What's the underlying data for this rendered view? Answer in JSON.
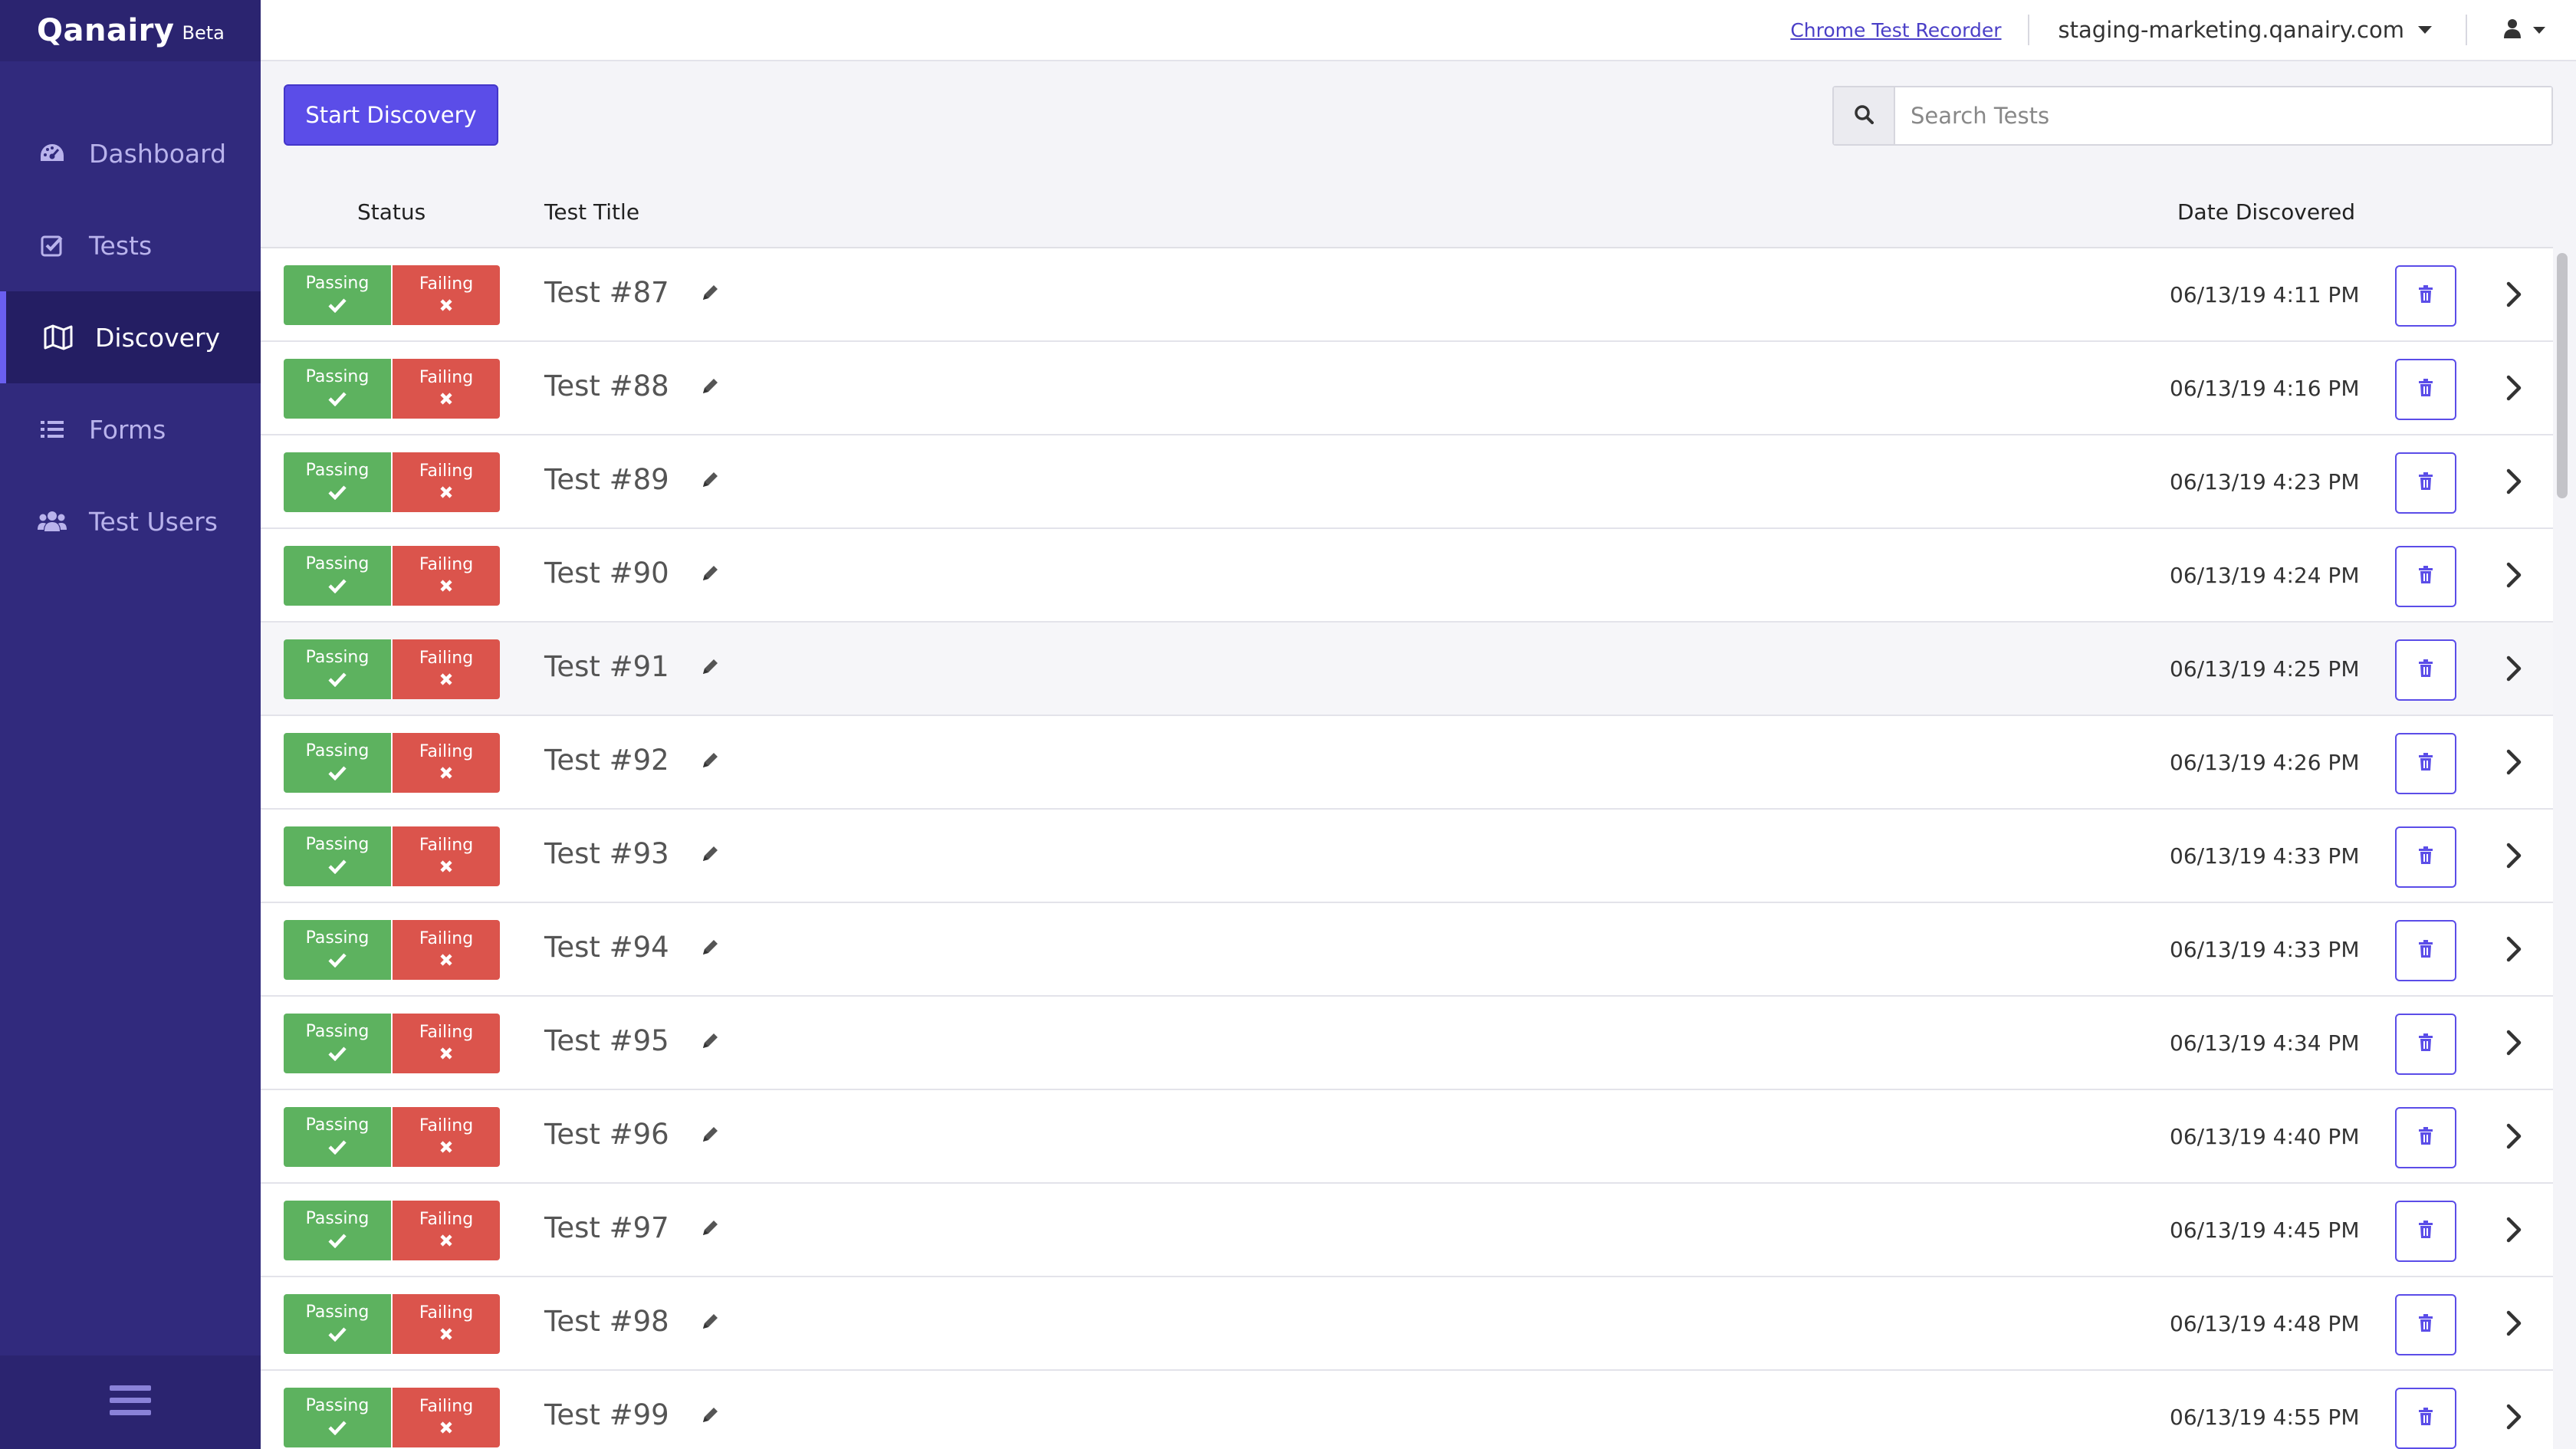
{
  "app": {
    "logo": "Qanairy",
    "beta_label": "Beta"
  },
  "topbar": {
    "recorder_link": "Chrome Test Recorder",
    "site": "staging-marketing.qanairy.com",
    "icons": [
      "user-icon",
      "caret-down-icon"
    ]
  },
  "sidebar": {
    "items": [
      {
        "label": "Dashboard",
        "icon": "dashboard-gauge-icon",
        "active": false
      },
      {
        "label": "Tests",
        "icon": "check-square-icon",
        "active": false
      },
      {
        "label": "Discovery",
        "icon": "map-icon",
        "active": true
      },
      {
        "label": "Forms",
        "icon": "list-icon",
        "active": false
      },
      {
        "label": "Test Users",
        "icon": "users-icon",
        "active": false
      }
    ],
    "footer_icon": "hamburger-menu-icon"
  },
  "toolbar": {
    "start_label": "Start Discovery",
    "search_placeholder": "Search Tests"
  },
  "table": {
    "headers": {
      "status": "Status",
      "title": "Test Title",
      "date": "Date Discovered"
    },
    "pass_label": "Passing",
    "fail_label": "Failing",
    "rows": [
      {
        "title": "Test #87",
        "date": "06/13/19 4:11 PM"
      },
      {
        "title": "Test #88",
        "date": "06/13/19 4:16 PM"
      },
      {
        "title": "Test #89",
        "date": "06/13/19 4:23 PM"
      },
      {
        "title": "Test #90",
        "date": "06/13/19 4:24 PM"
      },
      {
        "title": "Test #91",
        "date": "06/13/19 4:25 PM",
        "hover": true
      },
      {
        "title": "Test #92",
        "date": "06/13/19 4:26 PM"
      },
      {
        "title": "Test #93",
        "date": "06/13/19 4:33 PM"
      },
      {
        "title": "Test #94",
        "date": "06/13/19 4:33 PM"
      },
      {
        "title": "Test #95",
        "date": "06/13/19 4:34 PM"
      },
      {
        "title": "Test #96",
        "date": "06/13/19 4:40 PM"
      },
      {
        "title": "Test #97",
        "date": "06/13/19 4:45 PM"
      },
      {
        "title": "Test #98",
        "date": "06/13/19 4:48 PM"
      },
      {
        "title": "Test #99",
        "date": "06/13/19 4:55 PM"
      }
    ]
  },
  "colors": {
    "sidebar": "#312a7d",
    "accent": "#5b4de8",
    "passing": "#5db25f",
    "failing": "#db544c"
  }
}
